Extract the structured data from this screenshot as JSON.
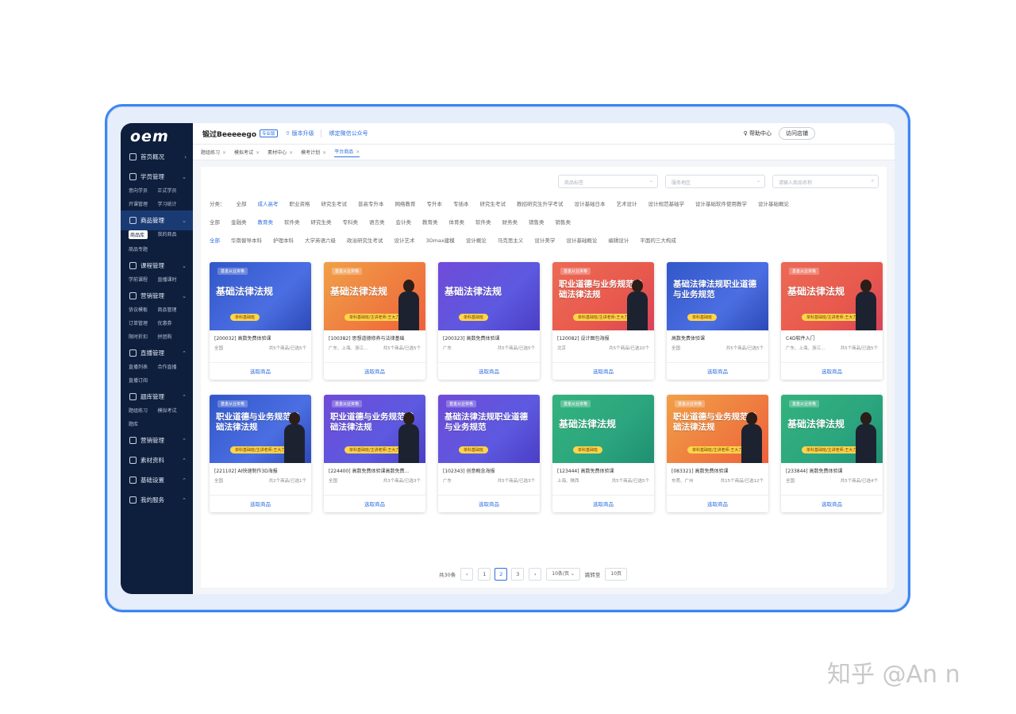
{
  "app": {
    "logo": "oem",
    "brand": "锻过Beeeeego",
    "brand_tag": "专业版",
    "upgrade": "⇧ 版本升级",
    "wechat": "绑定微信公众号",
    "help": "帮助中心",
    "visit_store": "访问店铺"
  },
  "sidebar": {
    "groups": [
      {
        "label": "首页概况",
        "arrow": "›",
        "subs": []
      },
      {
        "label": "学员管理",
        "arrow": "⌄",
        "subs": [
          "意向学员",
          "正式学员",
          "开课管理",
          "学习统计"
        ]
      },
      {
        "label": "商品管理",
        "arrow": "⌄",
        "subs": [
          "商品库",
          "我的商品",
          "商品专题"
        ],
        "active": true
      },
      {
        "label": "课程管理",
        "arrow": "⌄",
        "subs": [
          "学前课程",
          "直播课时"
        ]
      },
      {
        "label": "营销管理",
        "arrow": "⌄",
        "subs": [
          "协议模板",
          "商品管理",
          "订单管理",
          "优惠券",
          "限时折扣",
          "拼团购"
        ]
      },
      {
        "label": "直播管理",
        "arrow": "⌃",
        "subs": [
          "直播列表",
          "合作直播",
          "直播订阅"
        ]
      },
      {
        "label": "题库管理",
        "arrow": "⌃",
        "subs": [
          "题组练习",
          "模拟考试",
          "题库"
        ]
      },
      {
        "label": "营销管理",
        "arrow": "⌃",
        "subs": []
      },
      {
        "label": "素材资料",
        "arrow": "⌃",
        "subs": []
      },
      {
        "label": "基础设置",
        "arrow": "⌃",
        "subs": []
      },
      {
        "label": "我的服务",
        "arrow": "⌃",
        "subs": []
      }
    ]
  },
  "tabs": [
    "题组练习",
    "模拟考试",
    "素材中心",
    "模考计划",
    "平台商品"
  ],
  "filters": {
    "tag_placeholder": "商品标签",
    "region_placeholder": "服务地区",
    "search_placeholder": "请输入商品名称"
  },
  "categories": {
    "row1_label": "分类：",
    "row1": [
      "全部",
      "成人高考",
      "职业资格",
      "研究生考试",
      "普高专升本",
      "网络教育",
      "专升本",
      "专插本",
      "研究生考试",
      "教招研究生升学考试",
      "设计基础日本",
      "艺术设计",
      "设计规范基础学",
      "设计基础软件使用教学",
      "设计基础概论"
    ],
    "row2": [
      "全部",
      "金融类",
      "教育类",
      "软件类",
      "研究生类",
      "专科类",
      "语言类",
      "会计类",
      "教育类",
      "体育类",
      "软件类",
      "财务类",
      "销售类",
      "销售类"
    ],
    "row3": [
      "全部",
      "华南督导本科",
      "护理本科",
      "大学英语六级",
      "政治研究生考试",
      "设计艺术",
      "3Dmax建模",
      "设计概论",
      "马克思主义",
      "设计美学",
      "设计基础概论",
      "编辑设计",
      "平面的三大构成"
    ]
  },
  "cards": [
    {
      "theme": "blue",
      "tag": "基金从业资格",
      "title": "基础法律法规",
      "pill": "单科基础班",
      "person": false,
      "code": "[200032] 高数免费体验课",
      "region": "全国",
      "stat": "共5个商品/已选5个"
    },
    {
      "theme": "orange",
      "tag": "基金从业资格",
      "title": "基础法律法规",
      "pill": "单科基础班/主讲老师:王大力",
      "person": true,
      "code": "[100382] 思想道德修养与法律基础",
      "region": "广东、上海、浙江...",
      "stat": "共5个商品/已选5个"
    },
    {
      "theme": "purple",
      "tag": "",
      "title": "基础法律法规",
      "pill": "单科基础班",
      "person": false,
      "code": "[200323] 高数免费体验课",
      "region": "广东",
      "stat": "共5个商品/已选5个"
    },
    {
      "theme": "red",
      "tag": "基金从业资格",
      "title": "职业道德与业务规范基础法律法规",
      "pill": "单科基础班/主讲老师:王大力",
      "person": true,
      "code": "[120082] 设计图包海报",
      "region": "北京",
      "stat": "共5个商品/已选10个"
    },
    {
      "theme": "blue",
      "tag": "",
      "title": "基础法律法规职业道德与业务规范",
      "pill": "单科基础班",
      "person": false,
      "code": "高数免费体验课",
      "region": "全国",
      "stat": "共5个商品/已选5个"
    },
    {
      "theme": "red",
      "tag": "基金从业资格",
      "title": "基础法律法规",
      "pill": "单科基础班/主讲老师:王大力",
      "person": true,
      "code": "C4D软件入门",
      "region": "广东、上海、浙江...",
      "stat": "共5个商品/已选5个"
    },
    {
      "theme": "blue",
      "tag": "基金从业资格",
      "title": "职业道德与业务规范基础法律法规",
      "pill": "单科基础班/主讲老师:王大力",
      "person": true,
      "code": "[221102] AI快速制作3D海报",
      "region": "全国",
      "stat": "共2个商品/已选1个"
    },
    {
      "theme": "purple",
      "tag": "基金从业资格",
      "title": "职业道德与业务规范基础法律法规",
      "pill": "单科基础班/主讲老师:王大力",
      "person": true,
      "code": "[224400] 高数免费体验课高数免费...",
      "region": "全国",
      "stat": "共3个商品/已选3个"
    },
    {
      "theme": "purple",
      "tag": "基金从业资格",
      "title": "基础法律法规职业道德与业务规范",
      "pill": "单科基础班",
      "person": false,
      "code": "[102343] 创意概念海报",
      "region": "广东",
      "stat": "共5个商品/已选3个"
    },
    {
      "theme": "green",
      "tag": "基金从业资格",
      "title": "基础法律法规",
      "pill": "单科基础班",
      "person": false,
      "code": "[123444] 高数免费体验课",
      "region": "上海、陕西",
      "stat": "共5个商品/已选5个"
    },
    {
      "theme": "orange",
      "tag": "基金从业资格",
      "title": "职业道德与业务规范基础法律法规",
      "pill": "单科基础班/主讲老师:王大力",
      "person": true,
      "code": "[083321] 高数免费体验课",
      "region": "东莞、广州",
      "stat": "共15个商品/已选12个"
    },
    {
      "theme": "green",
      "tag": "基金从业资格",
      "title": "基础法律法规",
      "pill": "单科基础班/主讲老师:王大力",
      "person": true,
      "code": "[233844] 高数免费体验课",
      "region": "全国",
      "stat": "共5个商品/已选4个"
    }
  ],
  "pick_label": "选取商品",
  "pager": {
    "total": "共30条",
    "pages": [
      "1",
      "2",
      "3"
    ],
    "current": "2",
    "page_size": "10条/页",
    "goto_label": "跳转至",
    "goto_value": "10页"
  },
  "watermark": "知乎 @An n"
}
